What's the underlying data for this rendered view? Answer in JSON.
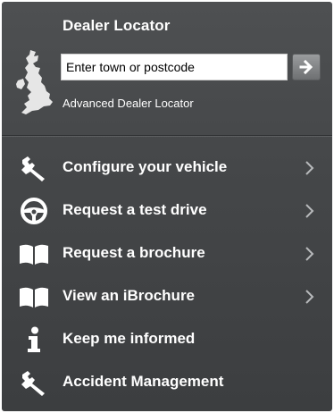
{
  "dealer_locator": {
    "title": "Dealer Locator",
    "search_placeholder": "Enter town or postcode",
    "search_value": "",
    "advanced_link": "Advanced Dealer Locator",
    "map_icon": "uk-map-icon",
    "go_icon": "arrow-right-icon"
  },
  "menu": {
    "items": [
      {
        "label": "Configure your vehicle",
        "icon": "wrench-icon",
        "has_chevron": true
      },
      {
        "label": "Request a test drive",
        "icon": "steering-wheel-icon",
        "has_chevron": true
      },
      {
        "label": "Request a brochure",
        "icon": "book-icon",
        "has_chevron": true
      },
      {
        "label": "View an iBrochure",
        "icon": "book-icon",
        "has_chevron": true
      },
      {
        "label": "Keep me informed",
        "icon": "info-icon",
        "has_chevron": false
      },
      {
        "label": "Accident Management",
        "icon": "wrench-icon",
        "has_chevron": false
      }
    ]
  },
  "colors": {
    "panel_background": "#46484a",
    "text": "#ffffff",
    "chevron": "#b8babc"
  }
}
